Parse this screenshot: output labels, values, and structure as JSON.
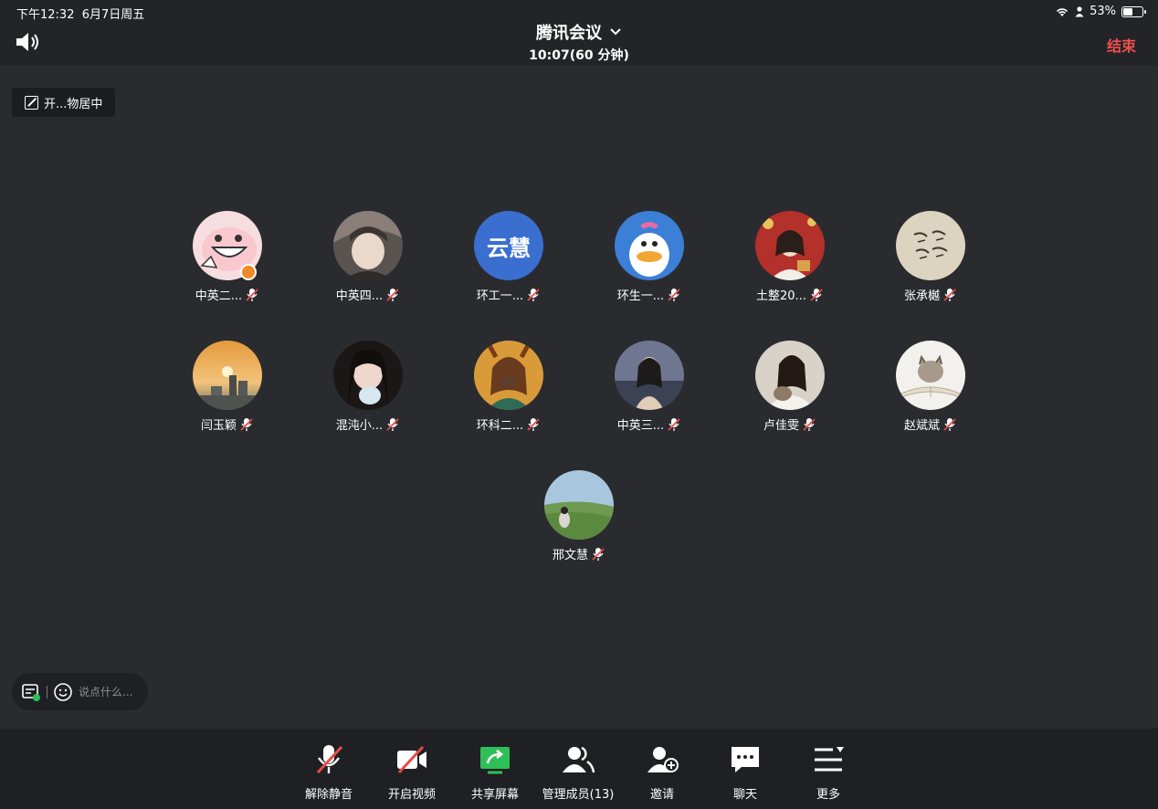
{
  "status_bar": {
    "time": "下午12:32",
    "date": "6月7日周五",
    "battery": "53%",
    "battery_level": 0.53
  },
  "header": {
    "title": "腾讯会议",
    "subtitle": "10:07(60 分钟)",
    "end_label": "结束"
  },
  "corner_tag": {
    "label": "开...物居中"
  },
  "participants": [
    {
      "name": "中英二...",
      "avatar": "pink-pig",
      "host": true
    },
    {
      "name": "中英四...",
      "avatar": "anime-boy"
    },
    {
      "name": "环工一...",
      "avatar_text": "云慧",
      "avatar": "text-blue"
    },
    {
      "name": "环生一...",
      "avatar": "donald-duck"
    },
    {
      "name": "土整20...",
      "avatar": "girl-red"
    },
    {
      "name": "张承樾",
      "avatar": "handwriting"
    },
    {
      "name": "闫玉颖",
      "avatar": "sunset-city"
    },
    {
      "name": "混沌小...",
      "avatar": "girl-drink"
    },
    {
      "name": "环科二...",
      "avatar": "anime-girl"
    },
    {
      "name": "中英三...",
      "avatar": "girl-lake"
    },
    {
      "name": "卢佳雯",
      "avatar": "girl-cat"
    },
    {
      "name": "赵斌斌",
      "avatar": "cat-book"
    },
    {
      "name": "邢文慧",
      "avatar": "hill-girl"
    }
  ],
  "chat_input": {
    "placeholder": "说点什么..."
  },
  "toolbar": {
    "unmute": "解除静音",
    "start_video": "开启视频",
    "share_screen": "共享屏幕",
    "manage_members": "管理成员(13)",
    "invite": "邀请",
    "chat": "聊天",
    "more": "更多"
  },
  "colors": {
    "background": "#2a2b2f",
    "end_red": "#ee4e4e",
    "share_green": "#2fbf58",
    "muted_red": "#e84b4b"
  }
}
